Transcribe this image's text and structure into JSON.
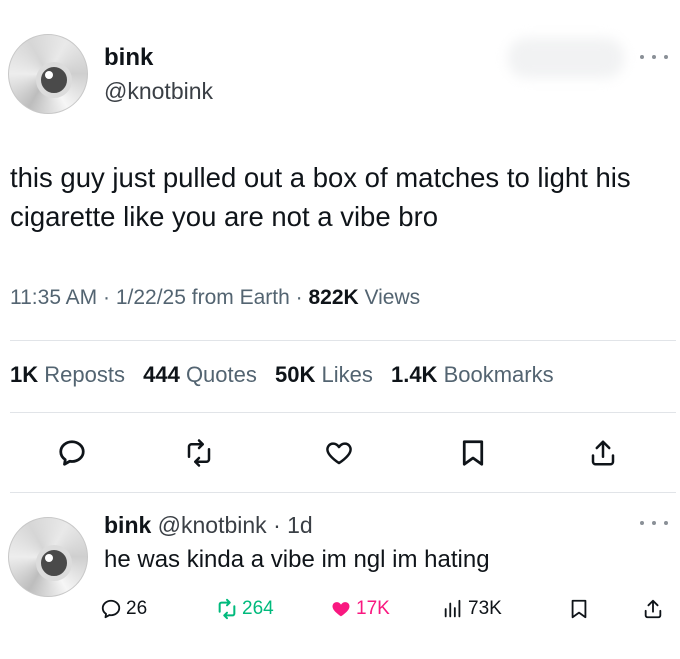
{
  "tweet": {
    "author": {
      "name": "bink",
      "handle": "@knotbink"
    },
    "text": "this guy just pulled out a box of matches to light his cigarette like you are not a vibe bro",
    "time": "11:35 AM",
    "date": "1/22/25",
    "source": "from Earth",
    "views_count": "822K",
    "views_label": "Views",
    "stats": {
      "reposts": {
        "count": "1K",
        "label": "Reposts"
      },
      "quotes": {
        "count": "444",
        "label": "Quotes"
      },
      "likes": {
        "count": "50K",
        "label": "Likes"
      },
      "bookmarks": {
        "count": "1.4K",
        "label": "Bookmarks"
      }
    },
    "actions": [
      "reply-icon",
      "repost-icon",
      "like-icon",
      "bookmark-icon",
      "share-icon"
    ]
  },
  "reply": {
    "author": {
      "name": "bink",
      "handle": "@knotbink"
    },
    "age": "1d",
    "text": "he was kinda a vibe im ngl im hating",
    "replies": "26",
    "reposts": "264",
    "likes": "17K",
    "views": "73K"
  },
  "colors": {
    "text": "#0f1419",
    "secondary": "#536471",
    "repost_green": "#00ba7c",
    "like_pink": "#f91880",
    "divider": "#e1e4e8"
  }
}
